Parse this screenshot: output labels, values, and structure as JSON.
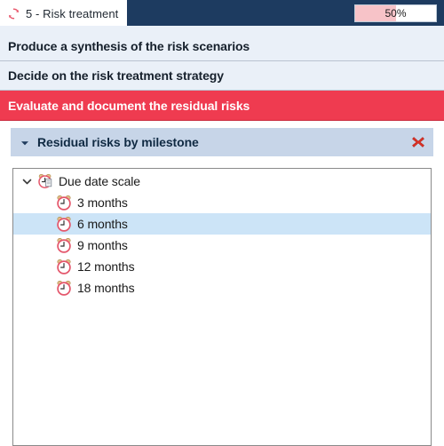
{
  "tab": {
    "label": "5 - Risk treatment",
    "icon": "cycle-refresh-icon",
    "progress": {
      "value": 50,
      "text": "50%",
      "fill_color": "#f7c3c8"
    }
  },
  "theme": {
    "navy": "#1d3b60",
    "row_bg": "#eaf0f8",
    "current_bg": "#ef3b50",
    "panel_header_bg": "#c7d5e8",
    "selection_bg": "#cce4f7",
    "close_red": "#d93025"
  },
  "tasks": [
    {
      "label": "Produce a synthesis of the risk scenarios",
      "state": "normal"
    },
    {
      "label": "Decide on the risk treatment strategy",
      "state": "normal"
    },
    {
      "label": "Evaluate and document the residual risks",
      "state": "current"
    }
  ],
  "panel": {
    "title": "Residual risks by milestone",
    "expanded": true,
    "collapse_icon": "chevron-down-icon",
    "close_icon": "close-x-icon"
  },
  "tree": {
    "root": {
      "label": "Due date scale",
      "icon": "clock-document-icon",
      "expanded": true,
      "twisty": "chevron-down-icon"
    },
    "children": [
      {
        "label": "3 months",
        "icon": "alarm-clock-icon",
        "selected": false
      },
      {
        "label": "6 months",
        "icon": "alarm-clock-icon",
        "selected": true
      },
      {
        "label": "9 months",
        "icon": "alarm-clock-icon",
        "selected": false
      },
      {
        "label": "12 months",
        "icon": "alarm-clock-icon",
        "selected": false
      },
      {
        "label": "18 months",
        "icon": "alarm-clock-icon",
        "selected": false
      }
    ]
  }
}
